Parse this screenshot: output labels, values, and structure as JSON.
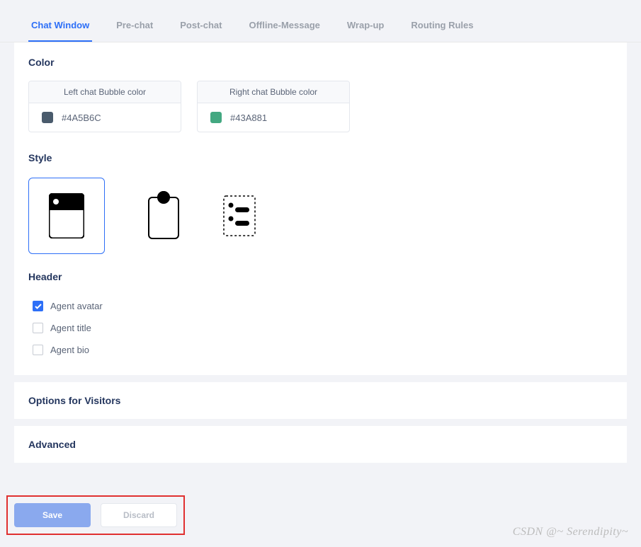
{
  "tabs": [
    {
      "label": "Chat Window",
      "active": true
    },
    {
      "label": "Pre-chat",
      "active": false
    },
    {
      "label": "Post-chat",
      "active": false
    },
    {
      "label": "Offline-Message",
      "active": false
    },
    {
      "label": "Wrap-up",
      "active": false
    },
    {
      "label": "Routing Rules",
      "active": false
    }
  ],
  "color": {
    "title": "Color",
    "left": {
      "label": "Left chat Bubble color",
      "hex": "#4A5B6C",
      "swatch": "#4A5B6C"
    },
    "right": {
      "label": "Right chat Bubble color",
      "hex": "#43A881",
      "swatch": "#43A881"
    }
  },
  "style": {
    "title": "Style",
    "selected_index": 0
  },
  "header": {
    "title": "Header",
    "items": [
      {
        "label": "Agent avatar",
        "checked": true
      },
      {
        "label": "Agent title",
        "checked": false
      },
      {
        "label": "Agent bio",
        "checked": false
      }
    ]
  },
  "sections": {
    "options_for_visitors": "Options for Visitors",
    "advanced": "Advanced"
  },
  "actions": {
    "save": "Save",
    "discard": "Discard"
  },
  "watermark": "CSDN @~ Serendipity~"
}
